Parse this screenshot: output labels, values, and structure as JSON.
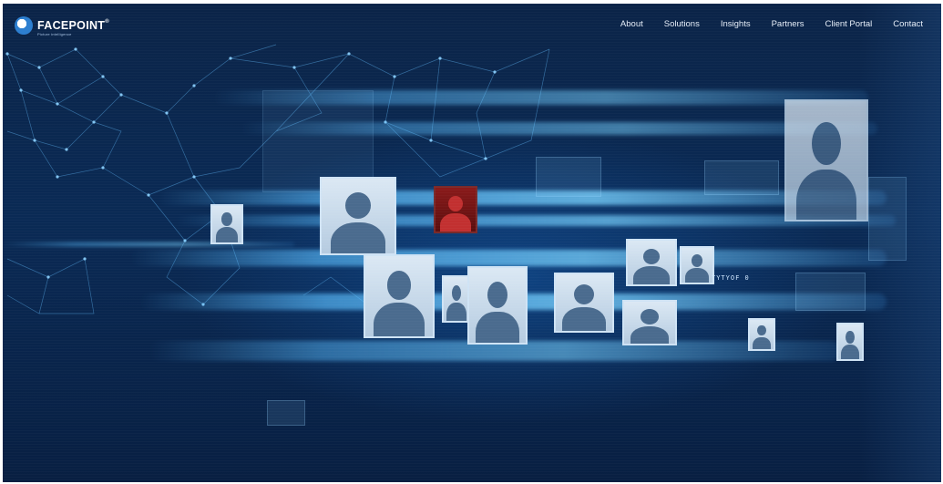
{
  "brand": {
    "name": "FACEPOINT",
    "trademark": "®",
    "tagline": "Picture intelligence"
  },
  "nav": {
    "items": [
      {
        "label": "About"
      },
      {
        "label": "Solutions"
      },
      {
        "label": "Insights"
      },
      {
        "label": "Partners"
      },
      {
        "label": "Client Portal"
      },
      {
        "label": "Contact"
      }
    ]
  },
  "hero": {
    "screen_code": "TYTYOF 0"
  },
  "colors": {
    "background": "#0a2a55",
    "accent": "#5ab4ff",
    "nav_text": "#e6eef8"
  }
}
